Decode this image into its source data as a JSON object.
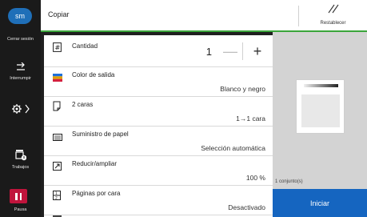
{
  "header": {
    "title": "Copiar",
    "reset_label": "Restablecer"
  },
  "rail": {
    "avatar_initials": "sm",
    "logout_label": "Cerrar sesión",
    "interrupt_label": "Interrumpir",
    "jobs_label": "Trabajos",
    "pause_label": "Pausa"
  },
  "settings": {
    "quantity": {
      "label": "Cantidad",
      "value": "1",
      "minus": "—",
      "plus": "+"
    },
    "color": {
      "label": "Color de salida",
      "value": "Blanco y negro"
    },
    "duplex": {
      "label": "2 caras",
      "value": "1→1 cara"
    },
    "paper": {
      "label": "Suministro de papel",
      "value": "Selección automática"
    },
    "zoom": {
      "label": "Reducir/ampliar",
      "value": "100 %"
    },
    "pages_per_sheet": {
      "label": "Páginas por cara",
      "value": "Desactivado"
    }
  },
  "preview": {
    "sets_label": "1 conjunto(s)"
  },
  "start_label": "Iniciar",
  "colors": {
    "accent_green": "#3aa53a",
    "start_blue": "#1565c0",
    "pause_red": "#c0143c",
    "avatar_blue": "#1f6fb8"
  }
}
